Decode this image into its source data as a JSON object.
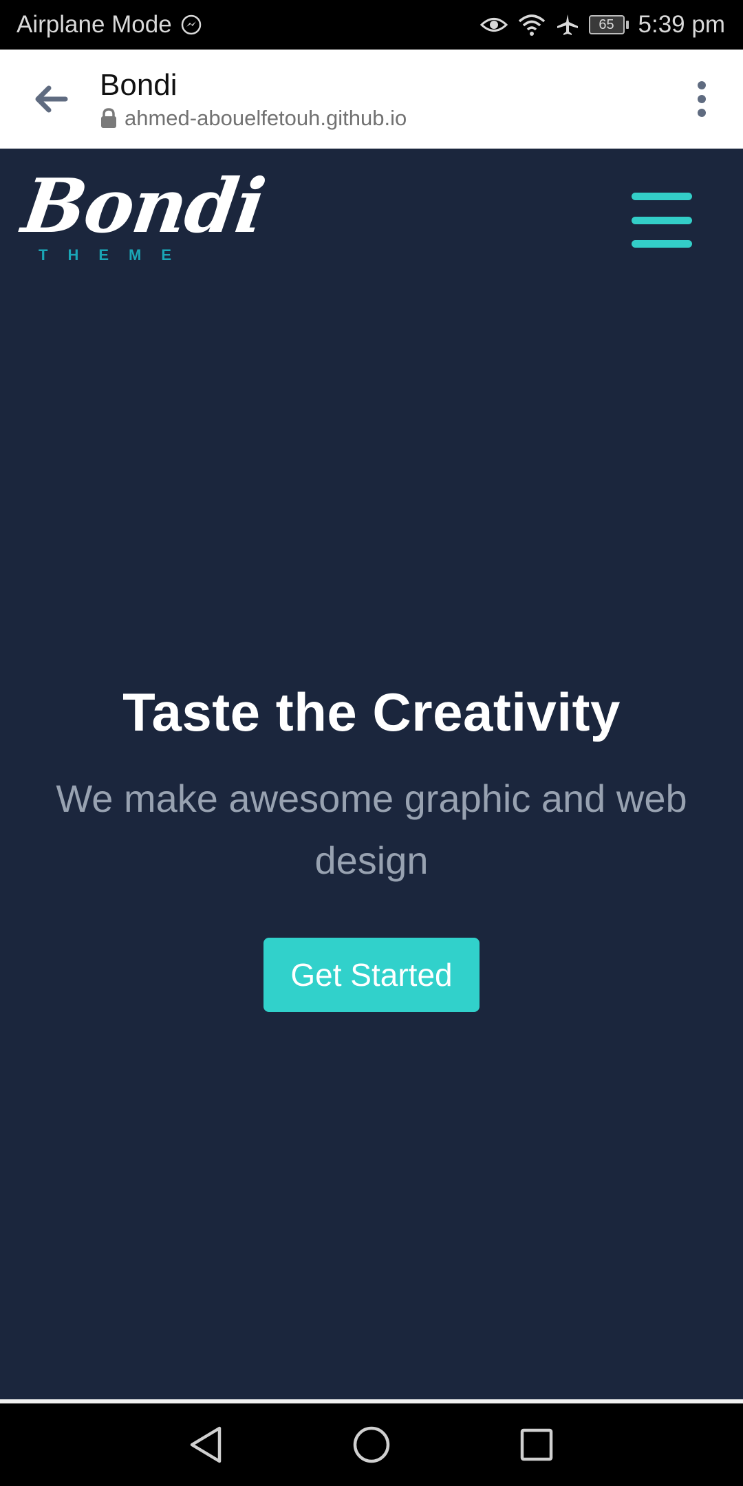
{
  "status_bar": {
    "left_text": "Airplane Mode",
    "battery_level": "65",
    "time": "5:39 pm",
    "icons": [
      "messenger-icon",
      "eye-icon",
      "wifi-icon",
      "airplane-icon",
      "battery-icon"
    ]
  },
  "toolbar": {
    "title": "Bondi",
    "url": "ahmed-abouelfetouh.github.io",
    "icons": [
      "back-arrow-icon",
      "lock-icon",
      "more-vert-icon"
    ]
  },
  "header": {
    "logo_word": "Bondi",
    "logo_sub": "THEME",
    "menu_icon": "hamburger-icon"
  },
  "hero": {
    "title": "Taste the Creativity",
    "subtitle": "We make awesome graphic and web design",
    "cta_label": "Get Started"
  },
  "nav_bar": {
    "icons": [
      "nav-back-icon",
      "nav-home-icon",
      "nav-recents-icon"
    ]
  },
  "colors": {
    "page_background": "#1b263d",
    "accent": "#31d1cb",
    "subtitle_text": "#98a2b1",
    "logo_sub_text": "#1aa6b6"
  }
}
